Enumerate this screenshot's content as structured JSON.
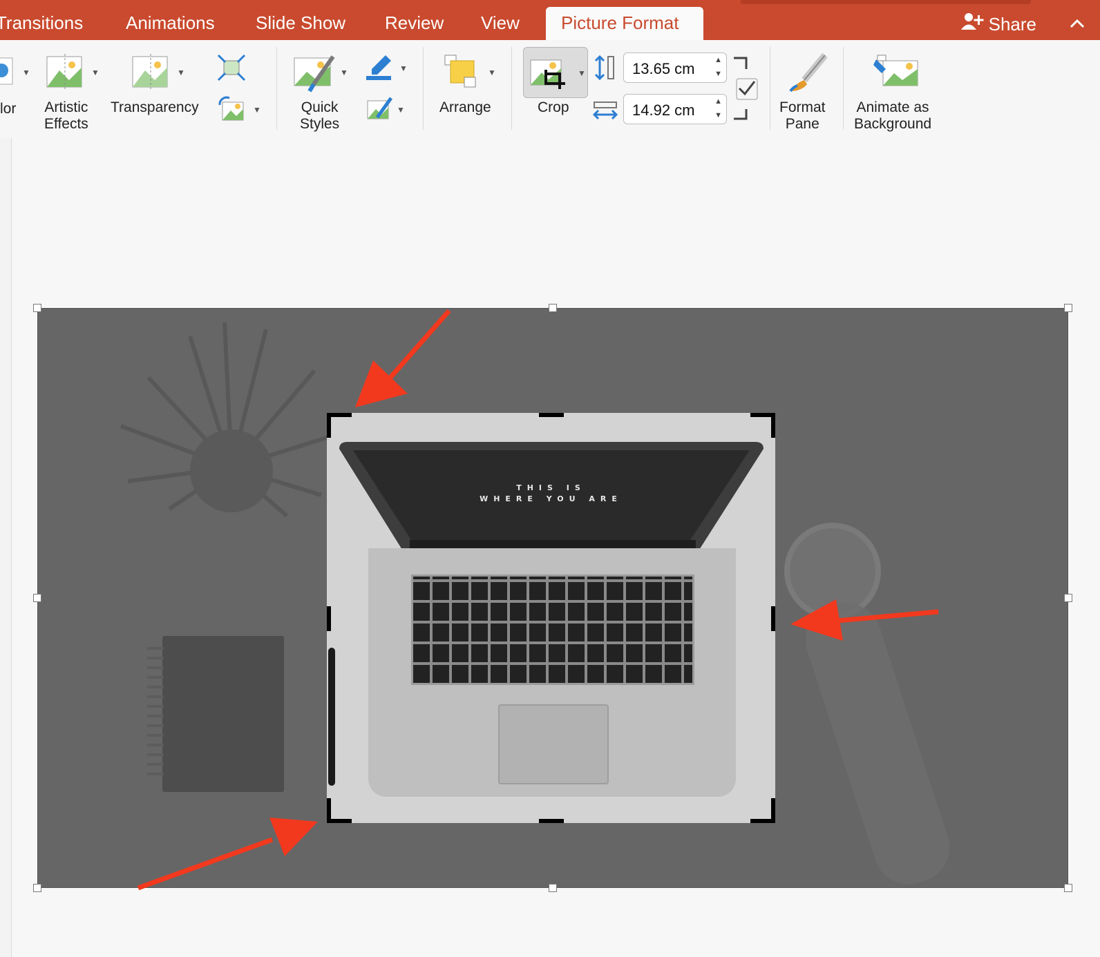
{
  "tabs": {
    "transitions": "Transitions",
    "animations": "Animations",
    "slide_show": "Slide Show",
    "review": "Review",
    "view": "View",
    "picture_format": "Picture Format"
  },
  "share_label": "Share",
  "ribbon": {
    "color_label": "lor",
    "artistic_effects_label": "Artistic\nEffects",
    "transparency_label": "Transparency",
    "quick_styles_label": "Quick\nStyles",
    "arrange_label": "Arrange",
    "crop_label": "Crop",
    "height_value": "13.65 cm",
    "width_value": "14.92 cm",
    "format_pane_label": "Format\nPane",
    "animate_bg_label": "Animate as\nBackground"
  },
  "laptop_screen_text": {
    "line1": "THIS IS",
    "line2": "WHERE YOU ARE"
  },
  "colors": {
    "tab_bar": "#c94a2e",
    "accent": "#c94a2e",
    "arrow": "#f2391e",
    "image_bg": "#666666"
  }
}
